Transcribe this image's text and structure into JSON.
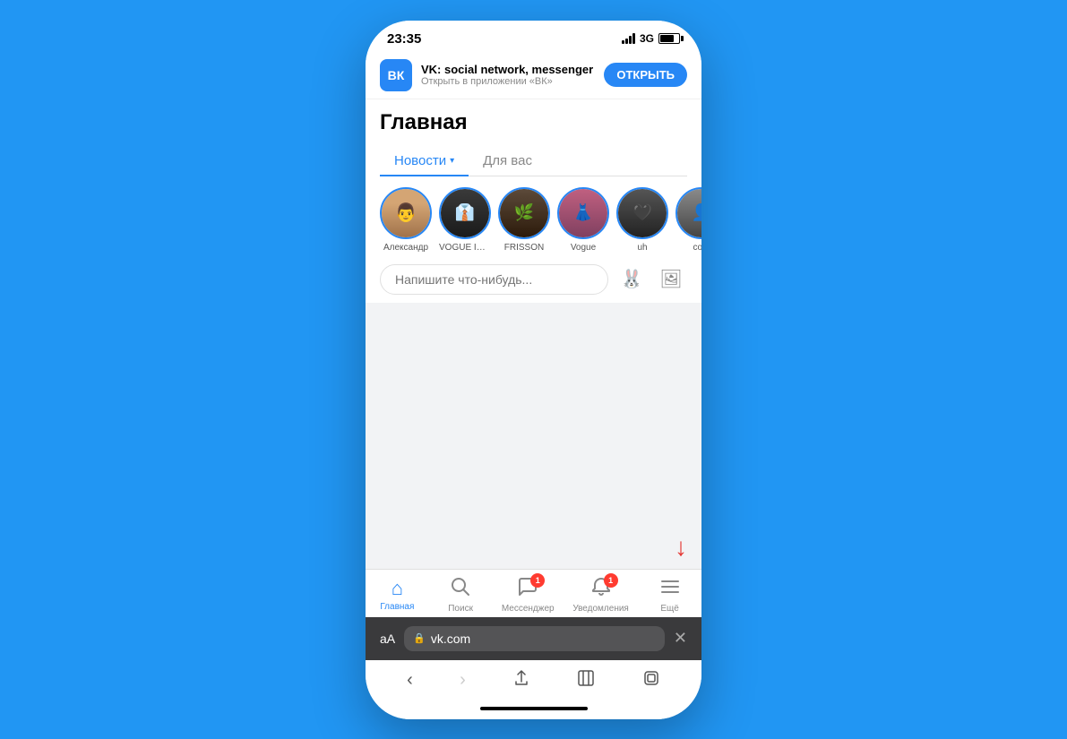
{
  "statusBar": {
    "time": "23:35",
    "network": "3G"
  },
  "appBanner": {
    "appName": "VK: social network, messenger",
    "subtitle": "Открыть в приложении «ВК»",
    "buttonLabel": "ОТКРЫТЬ"
  },
  "page": {
    "title": "Главная",
    "tabs": [
      {
        "label": "Новости",
        "active": true,
        "hasArrow": true
      },
      {
        "label": "Для вас",
        "active": false
      }
    ]
  },
  "stories": [
    {
      "id": 1,
      "name": "Александр",
      "emoji": "👨"
    },
    {
      "id": 2,
      "name": "VOGUE IS ...",
      "emoji": "👔"
    },
    {
      "id": 3,
      "name": "FRISSON",
      "emoji": "🌿"
    },
    {
      "id": 4,
      "name": "Vogue",
      "emoji": "👗"
    },
    {
      "id": 5,
      "name": "uh",
      "emoji": "🖤"
    },
    {
      "id": 6,
      "name": "co...",
      "emoji": "👤"
    }
  ],
  "postInput": {
    "placeholder": "Напишите что-нибудь..."
  },
  "bottomNav": [
    {
      "id": "home",
      "icon": "⌂",
      "label": "Главная",
      "active": true,
      "badge": null
    },
    {
      "id": "search",
      "icon": "🔍",
      "label": "Поиск",
      "active": false,
      "badge": null
    },
    {
      "id": "messenger",
      "icon": "💬",
      "label": "Мессенджер",
      "active": false,
      "badge": "1"
    },
    {
      "id": "notifications",
      "icon": "🔔",
      "label": "Уведомления",
      "active": false,
      "badge": "1"
    },
    {
      "id": "more",
      "icon": "☰",
      "label": "Ещё",
      "active": false,
      "badge": null
    }
  ],
  "browserBar": {
    "aaLabel": "аА",
    "url": "vk.com",
    "lockIcon": "🔒"
  }
}
